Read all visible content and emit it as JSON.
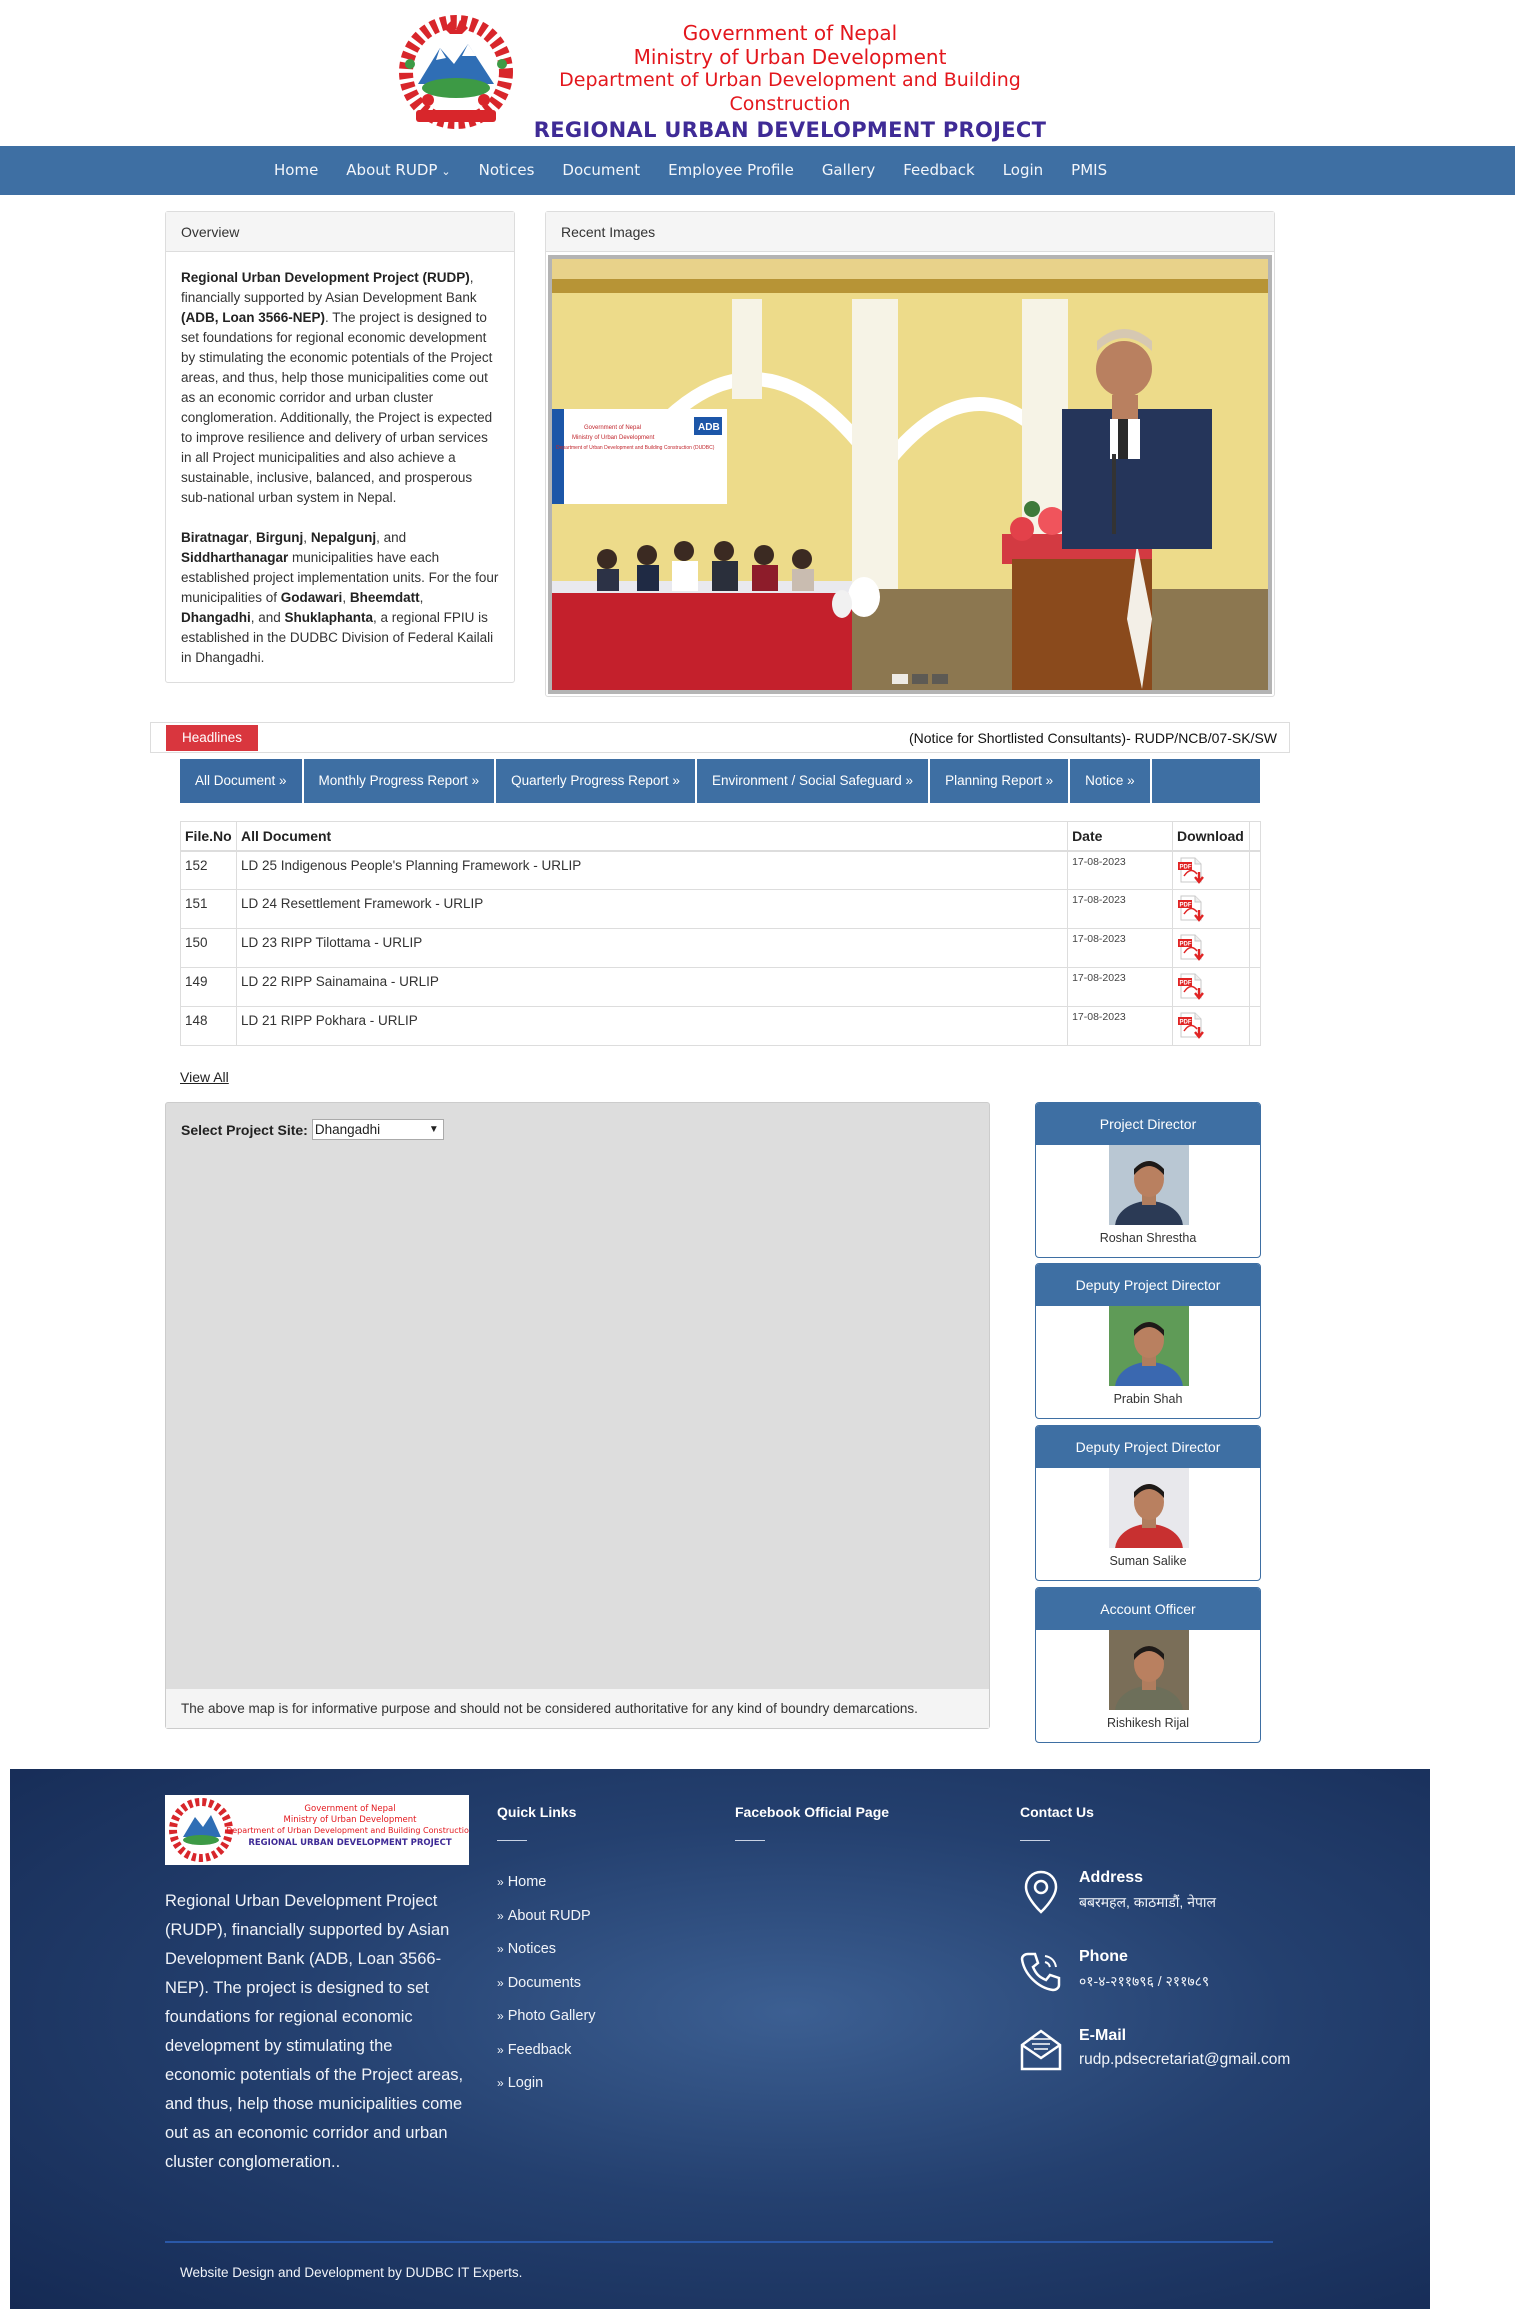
{
  "header": {
    "line1": "Government of Nepal",
    "line2": "Ministry of Urban Development",
    "line3": "Department of Urban Development and Building Construction",
    "project": "REGIONAL URBAN DEVELOPMENT PROJECT"
  },
  "nav": {
    "items": [
      {
        "label": "Home"
      },
      {
        "label": "About RUDP",
        "has_dropdown": true
      },
      {
        "label": "Notices"
      },
      {
        "label": "Document"
      },
      {
        "label": "Employee Profile"
      },
      {
        "label": "Gallery"
      },
      {
        "label": "Feedback"
      },
      {
        "label": "Login"
      },
      {
        "label": "PMIS"
      }
    ]
  },
  "overview": {
    "title": "Overview",
    "p1_bold1": "Regional Urban Development Project (RUDP)",
    "p1_text1": ", financially supported by Asian Development Bank ",
    "p1_bold2": "(ADB, Loan 3566-NEP)",
    "p1_text2": ". The project is designed to set foundations for regional economic development by stimulating the economic potentials of the Project areas, and thus, help those municipalities come out as an economic corridor and urban cluster conglomeration. Additionally, the Project is expected to improve resilience and delivery of urban services in all Project municipalities and also achieve a sustainable, inclusive, balanced, and prosperous sub-national urban system in Nepal.",
    "p2_b1": "Biratnagar",
    "p2_t1": ", ",
    "p2_b2": "Birgunj",
    "p2_t2": ", ",
    "p2_b3": "Nepalgunj",
    "p2_t3": ", and ",
    "p2_b4": "Siddharthanagar",
    "p2_t4": " municipalities have each established project implementation units. For the four municipalities of ",
    "p2_b5": "Godawari",
    "p2_t5": ", ",
    "p2_b6": "Bheemdatt",
    "p2_t6": ", ",
    "p2_b7": "Dhangadhi",
    "p2_t7": ", and ",
    "p2_b8": "Shuklaphanta",
    "p2_t8": ", a regional FPIU is established in the DUDBC Division of Federal Kailali in Dhangadhi."
  },
  "recent_images": {
    "title": "Recent Images",
    "banner_l1": "Government of Nepal",
    "banner_l2": "Ministry of Urban Development",
    "banner_l3": "Department of Urban Development and Building Construction (DUDBC)",
    "banner_logo": "ADB",
    "dots": 3,
    "active_dot": 0
  },
  "headlines": {
    "badge": "Headlines",
    "text": "(Notice for Shortlisted Consultants)- RUDP/NCB/07-SK/SW"
  },
  "doc_tabs": [
    {
      "label": "All Document »"
    },
    {
      "label": "Monthly Progress Report »"
    },
    {
      "label": "Quarterly Progress Report »"
    },
    {
      "label": "Environment / Social Safeguard »"
    },
    {
      "label": "Planning Report »"
    },
    {
      "label": "Notice »"
    }
  ],
  "doc_table": {
    "headers": {
      "file_no": "File.No",
      "title": "All Document",
      "date": "Date",
      "download": "Download"
    },
    "rows": [
      {
        "no": "152",
        "title": "LD 25 Indigenous People's Planning Framework - URLIP",
        "date": "17-08-2023"
      },
      {
        "no": "151",
        "title": "LD 24 Resettlement Framework - URLIP",
        "date": "17-08-2023"
      },
      {
        "no": "150",
        "title": "LD 23 RIPP Tilottama - URLIP",
        "date": "17-08-2023"
      },
      {
        "no": "149",
        "title": "LD 22 RIPP Sainamaina - URLIP",
        "date": "17-08-2023"
      },
      {
        "no": "148",
        "title": "LD 21 RIPP Pokhara - URLIP",
        "date": "17-08-2023"
      }
    ],
    "pdf_icon": "pdf-download-icon",
    "view_all": "View All"
  },
  "map": {
    "select_label": "Select Project Site:",
    "selected_site": "Dhangadhi",
    "note": "The above map is for informative purpose and should not be considered authoritative for any kind of boundry demarcations."
  },
  "staff": [
    {
      "role": "Project Director",
      "name": "Roshan Shrestha",
      "shirt": "#2b3a55",
      "bg": "#b9c7d3"
    },
    {
      "role": "Deputy Project Director",
      "name": "Prabin Shah",
      "shirt": "#3a68b0",
      "bg": "#5f9b57"
    },
    {
      "role": "Deputy Project Director",
      "name": "Suman Salike",
      "shirt": "#c83030",
      "bg": "#e8e8ec"
    },
    {
      "role": "Account Officer",
      "name": "Rishikesh Rijal",
      "shirt": "#6d6f5a",
      "bg": "#7a6e58"
    }
  ],
  "footer": {
    "logo_l1": "Government of Nepal",
    "logo_l2": "Ministry of Urban Development",
    "logo_l3": "Department of Urban Development and Building Construction",
    "logo_project": "REGIONAL URBAN DEVELOPMENT PROJECT",
    "about": "Regional Urban Development Project (RUDP), financially supported by Asian Development Bank (ADB, Loan 3566-NEP). The project is designed to set foundations for regional economic development by stimulating the economic potentials of the Project areas, and thus, help those municipalities come out as an economic corridor and urban cluster conglomeration..",
    "quick_links_title": "Quick Links",
    "quick_links": [
      {
        "label": "Home"
      },
      {
        "label": "About RUDP"
      },
      {
        "label": "Notices"
      },
      {
        "label": "Documents"
      },
      {
        "label": "Photo Gallery"
      },
      {
        "label": "Feedback"
      },
      {
        "label": "Login"
      }
    ],
    "facebook_title": "Facebook Official Page",
    "contact_title": "Contact Us",
    "address_title": "Address",
    "address_value": "बबरमहल, काठमाडौं, नेपाल",
    "phone_title": "Phone",
    "phone_value": "०१-४-२११७९६ / २११७८९",
    "email_title": "E-Mail",
    "email_value": "rudp.pdsecretariat@gmail.com",
    "credit": "Website Design and Development by DUDBC IT Experts."
  },
  "colors": {
    "nav_bg": "#3e6fa3",
    "header_red": "#e3171d",
    "header_project": "#3f2b96",
    "headline_badge": "#d9363e",
    "footer_bg": "#1f3866"
  }
}
